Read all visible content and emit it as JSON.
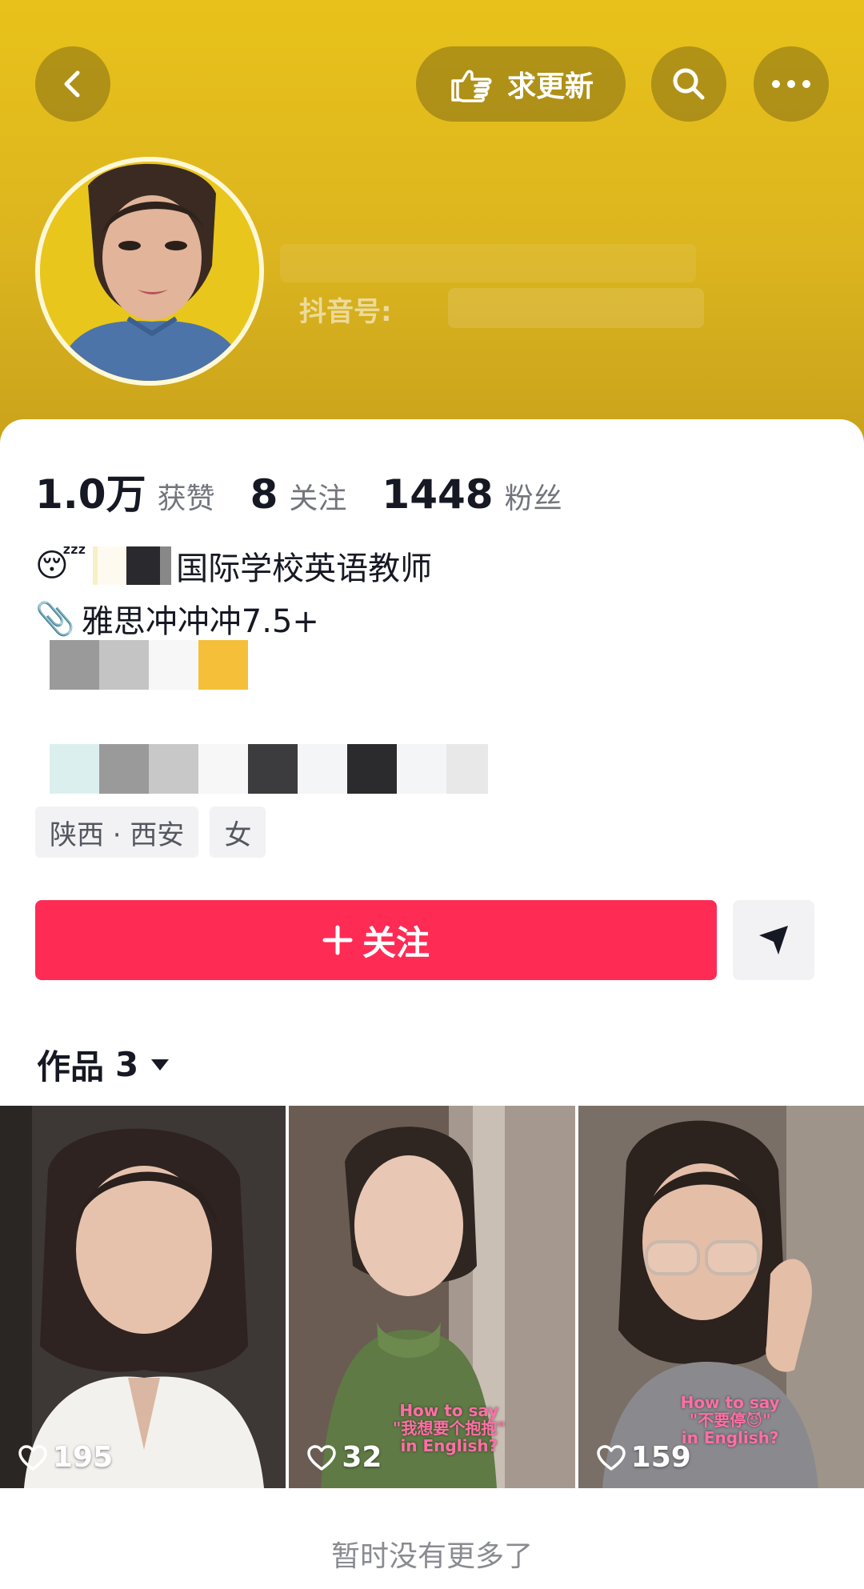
{
  "header": {
    "request_update_label": "求更新",
    "douyin_id_label": "抖音号:"
  },
  "stats": [
    {
      "value": "1.0万",
      "label": "获赞"
    },
    {
      "value": "8",
      "label": "关注"
    },
    {
      "value": "1448",
      "label": "粉丝"
    }
  ],
  "bio": {
    "line1_emoji": "😴",
    "line1_text": "国际学校英语教师",
    "line2_emoji": "📎",
    "line2_text": "雅思冲冲冲7.5+"
  },
  "tags": [
    "陕西 · 西安",
    "女"
  ],
  "follow_button": {
    "label": "关注",
    "icon": "plus-icon"
  },
  "works": {
    "label": "作品",
    "count": "3"
  },
  "videos": [
    {
      "likes": "195",
      "caption": ""
    },
    {
      "likes": "32",
      "caption": "How to say\n\"我想要个抱抱\"\nin English?"
    },
    {
      "likes": "159",
      "caption": "How to say\n\"不要停😈\"\nin English?"
    }
  ],
  "footer": {
    "message": "暂时没有更多了"
  },
  "colors": {
    "banner": "#dcb51f",
    "follow": "#fe2c55",
    "text": "#161823",
    "muted": "#73757d"
  }
}
